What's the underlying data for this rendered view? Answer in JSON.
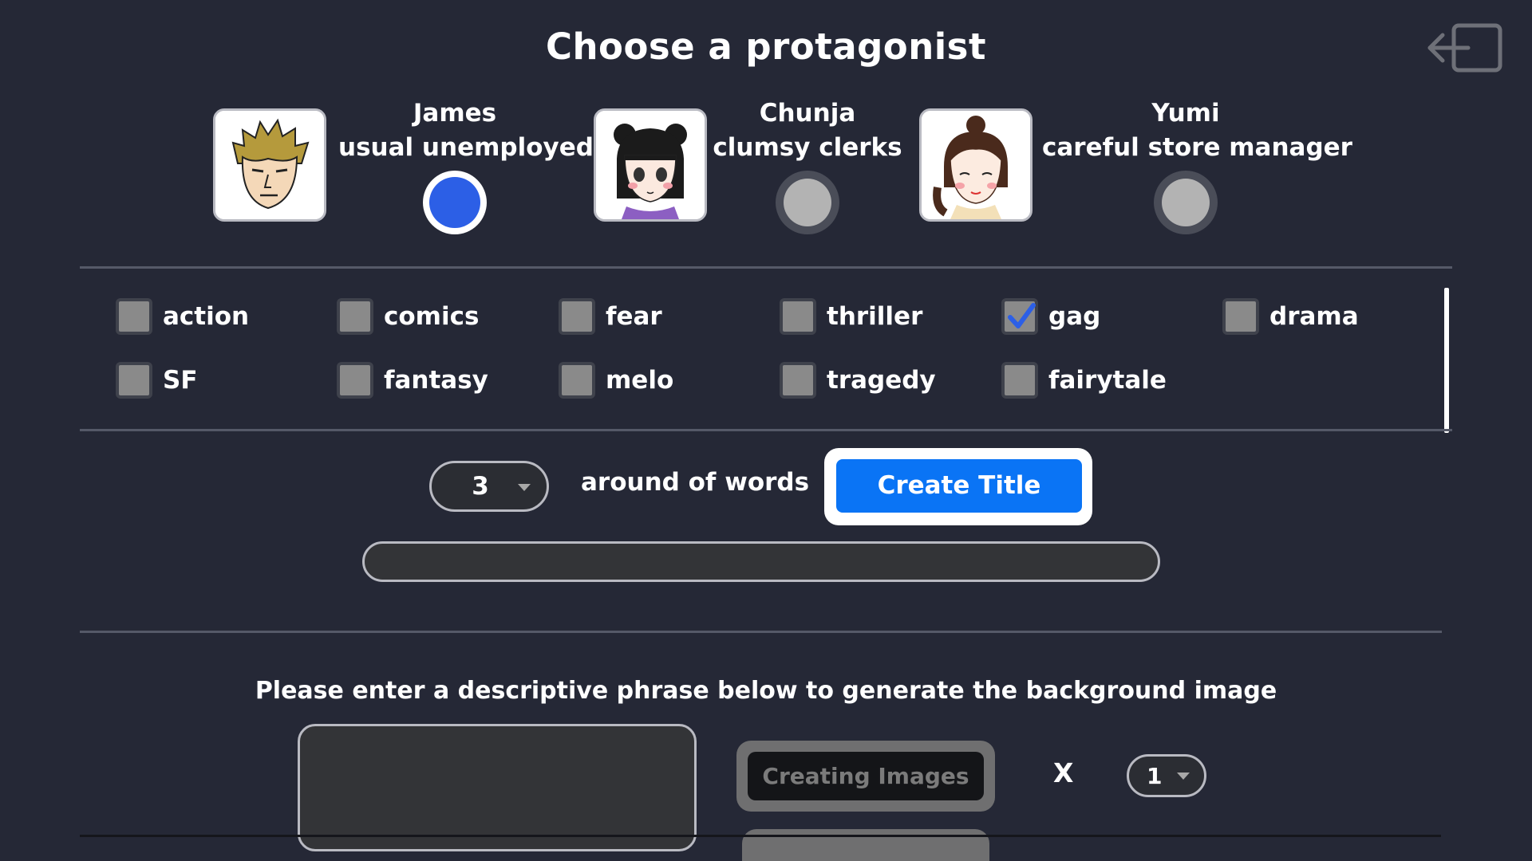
{
  "page_title": "Choose a protagonist",
  "exit_icon": "exit-arrow-icon",
  "protagonists": [
    {
      "name": "James",
      "role": "usual unemployed",
      "selected": true,
      "avatar": "james-portrait"
    },
    {
      "name": "Chunja",
      "role": "clumsy clerks",
      "selected": false,
      "avatar": "chunja-portrait"
    },
    {
      "name": "Yumi",
      "role": "careful store manager",
      "selected": false,
      "avatar": "yumi-portrait"
    }
  ],
  "genres": [
    {
      "label": "action",
      "checked": false
    },
    {
      "label": "comics",
      "checked": false
    },
    {
      "label": "fear",
      "checked": false
    },
    {
      "label": "thriller",
      "checked": false
    },
    {
      "label": "gag",
      "checked": true
    },
    {
      "label": "drama",
      "checked": false
    },
    {
      "label": "SF",
      "checked": false
    },
    {
      "label": "fantasy",
      "checked": false
    },
    {
      "label": "melo",
      "checked": false
    },
    {
      "label": "tragedy",
      "checked": false
    },
    {
      "label": "fairytale",
      "checked": false
    }
  ],
  "title_generator": {
    "word_count": "3",
    "word_count_label": "around of words",
    "create_button": "Create Title",
    "title_value": ""
  },
  "background": {
    "prompt_text": "Please enter a descriptive phrase below to generate the background image",
    "phrase_value": "",
    "creating_button": "Creating Images",
    "times_label": "X",
    "image_count": "1"
  },
  "colors": {
    "background": "#252836",
    "accent_blue": "#0a74f5",
    "radio_selected": "#2c5fe6",
    "checkmark": "#2c5fe6"
  }
}
